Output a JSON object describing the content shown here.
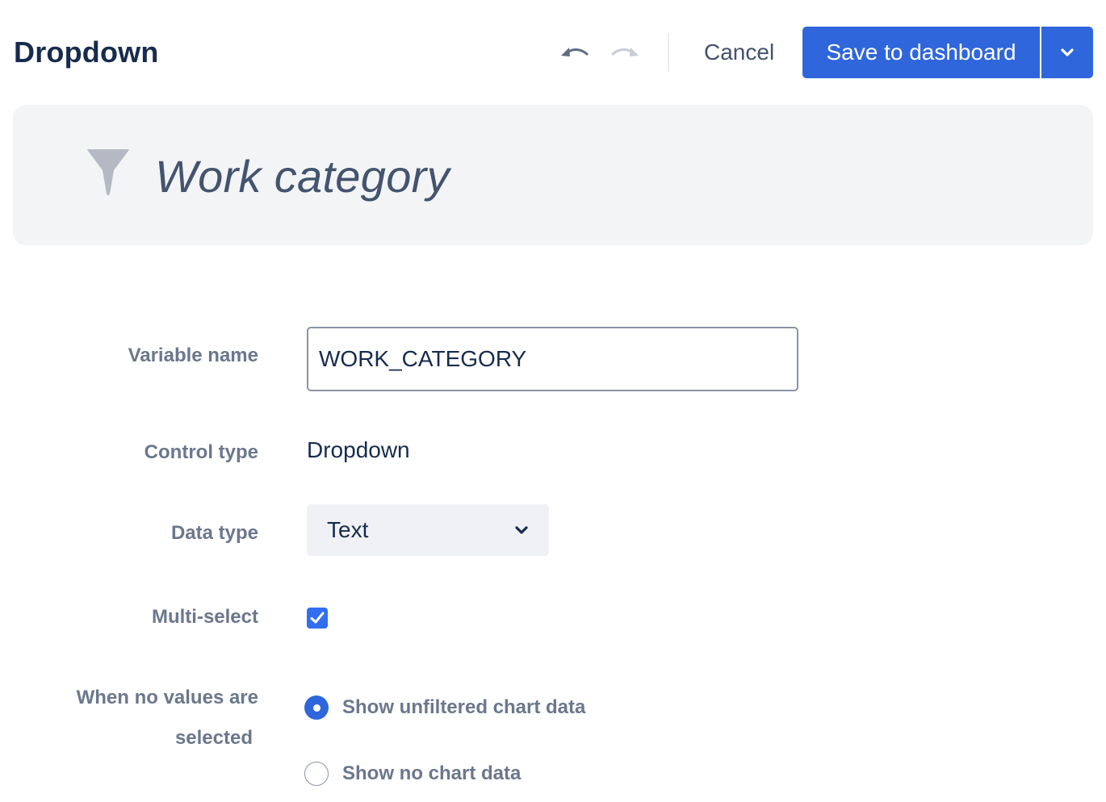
{
  "header": {
    "title": "Dropdown",
    "undo_icon": "undo-arrow-icon",
    "redo_icon": "redo-arrow-icon",
    "cancel_label": "Cancel",
    "save_label": "Save to dashboard",
    "save_menu_icon": "chevron-down-icon"
  },
  "banner": {
    "icon": "filter-funnel-icon",
    "title": "Work category"
  },
  "form": {
    "variable_name": {
      "label": "Variable name",
      "value": "WORK_CATEGORY"
    },
    "control_type": {
      "label": "Control type",
      "value": "Dropdown"
    },
    "data_type": {
      "label": "Data type",
      "selected": "Text",
      "icon": "chevron-down-icon"
    },
    "multi_select": {
      "label": "Multi-select",
      "checked": true
    },
    "no_values": {
      "label_line1": "When no values are",
      "label_line2": "selected",
      "options": [
        {
          "label": "Show unfiltered chart data",
          "checked": true
        },
        {
          "label": "Show no chart data",
          "checked": false
        }
      ]
    }
  },
  "colors": {
    "primary": "#2f66db",
    "title_text": "#172b4d",
    "label_text": "#6b778c",
    "banner_bg": "#f3f4f6"
  }
}
